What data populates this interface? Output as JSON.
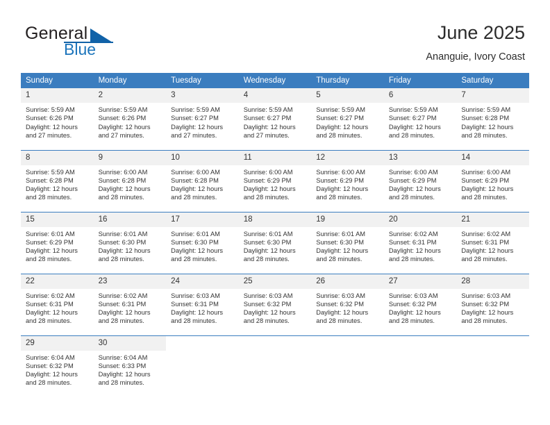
{
  "brand": {
    "name_top": "General",
    "name_bottom": "Blue",
    "accent_color": "#1162a8"
  },
  "header": {
    "title": "June 2025",
    "subtitle": "Ananguie, Ivory Coast",
    "header_bg": "#3b7dbf",
    "daynum_bg": "#f1f1f1"
  },
  "weekdays": [
    "Sunday",
    "Monday",
    "Tuesday",
    "Wednesday",
    "Thursday",
    "Friday",
    "Saturday"
  ],
  "labels": {
    "sunrise_prefix": "Sunrise:",
    "sunset_prefix": "Sunset:",
    "daylight_prefix": "Daylight:"
  },
  "weeks": [
    [
      {
        "day": "1",
        "sunrise": "Sunrise: 5:59 AM",
        "sunset": "Sunset: 6:26 PM",
        "daylight_1": "Daylight: 12 hours",
        "daylight_2": "and 27 minutes."
      },
      {
        "day": "2",
        "sunrise": "Sunrise: 5:59 AM",
        "sunset": "Sunset: 6:26 PM",
        "daylight_1": "Daylight: 12 hours",
        "daylight_2": "and 27 minutes."
      },
      {
        "day": "3",
        "sunrise": "Sunrise: 5:59 AM",
        "sunset": "Sunset: 6:27 PM",
        "daylight_1": "Daylight: 12 hours",
        "daylight_2": "and 27 minutes."
      },
      {
        "day": "4",
        "sunrise": "Sunrise: 5:59 AM",
        "sunset": "Sunset: 6:27 PM",
        "daylight_1": "Daylight: 12 hours",
        "daylight_2": "and 27 minutes."
      },
      {
        "day": "5",
        "sunrise": "Sunrise: 5:59 AM",
        "sunset": "Sunset: 6:27 PM",
        "daylight_1": "Daylight: 12 hours",
        "daylight_2": "and 28 minutes."
      },
      {
        "day": "6",
        "sunrise": "Sunrise: 5:59 AM",
        "sunset": "Sunset: 6:27 PM",
        "daylight_1": "Daylight: 12 hours",
        "daylight_2": "and 28 minutes."
      },
      {
        "day": "7",
        "sunrise": "Sunrise: 5:59 AM",
        "sunset": "Sunset: 6:28 PM",
        "daylight_1": "Daylight: 12 hours",
        "daylight_2": "and 28 minutes."
      }
    ],
    [
      {
        "day": "8",
        "sunrise": "Sunrise: 5:59 AM",
        "sunset": "Sunset: 6:28 PM",
        "daylight_1": "Daylight: 12 hours",
        "daylight_2": "and 28 minutes."
      },
      {
        "day": "9",
        "sunrise": "Sunrise: 6:00 AM",
        "sunset": "Sunset: 6:28 PM",
        "daylight_1": "Daylight: 12 hours",
        "daylight_2": "and 28 minutes."
      },
      {
        "day": "10",
        "sunrise": "Sunrise: 6:00 AM",
        "sunset": "Sunset: 6:28 PM",
        "daylight_1": "Daylight: 12 hours",
        "daylight_2": "and 28 minutes."
      },
      {
        "day": "11",
        "sunrise": "Sunrise: 6:00 AM",
        "sunset": "Sunset: 6:29 PM",
        "daylight_1": "Daylight: 12 hours",
        "daylight_2": "and 28 minutes."
      },
      {
        "day": "12",
        "sunrise": "Sunrise: 6:00 AM",
        "sunset": "Sunset: 6:29 PM",
        "daylight_1": "Daylight: 12 hours",
        "daylight_2": "and 28 minutes."
      },
      {
        "day": "13",
        "sunrise": "Sunrise: 6:00 AM",
        "sunset": "Sunset: 6:29 PM",
        "daylight_1": "Daylight: 12 hours",
        "daylight_2": "and 28 minutes."
      },
      {
        "day": "14",
        "sunrise": "Sunrise: 6:00 AM",
        "sunset": "Sunset: 6:29 PM",
        "daylight_1": "Daylight: 12 hours",
        "daylight_2": "and 28 minutes."
      }
    ],
    [
      {
        "day": "15",
        "sunrise": "Sunrise: 6:01 AM",
        "sunset": "Sunset: 6:29 PM",
        "daylight_1": "Daylight: 12 hours",
        "daylight_2": "and 28 minutes."
      },
      {
        "day": "16",
        "sunrise": "Sunrise: 6:01 AM",
        "sunset": "Sunset: 6:30 PM",
        "daylight_1": "Daylight: 12 hours",
        "daylight_2": "and 28 minutes."
      },
      {
        "day": "17",
        "sunrise": "Sunrise: 6:01 AM",
        "sunset": "Sunset: 6:30 PM",
        "daylight_1": "Daylight: 12 hours",
        "daylight_2": "and 28 minutes."
      },
      {
        "day": "18",
        "sunrise": "Sunrise: 6:01 AM",
        "sunset": "Sunset: 6:30 PM",
        "daylight_1": "Daylight: 12 hours",
        "daylight_2": "and 28 minutes."
      },
      {
        "day": "19",
        "sunrise": "Sunrise: 6:01 AM",
        "sunset": "Sunset: 6:30 PM",
        "daylight_1": "Daylight: 12 hours",
        "daylight_2": "and 28 minutes."
      },
      {
        "day": "20",
        "sunrise": "Sunrise: 6:02 AM",
        "sunset": "Sunset: 6:31 PM",
        "daylight_1": "Daylight: 12 hours",
        "daylight_2": "and 28 minutes."
      },
      {
        "day": "21",
        "sunrise": "Sunrise: 6:02 AM",
        "sunset": "Sunset: 6:31 PM",
        "daylight_1": "Daylight: 12 hours",
        "daylight_2": "and 28 minutes."
      }
    ],
    [
      {
        "day": "22",
        "sunrise": "Sunrise: 6:02 AM",
        "sunset": "Sunset: 6:31 PM",
        "daylight_1": "Daylight: 12 hours",
        "daylight_2": "and 28 minutes."
      },
      {
        "day": "23",
        "sunrise": "Sunrise: 6:02 AM",
        "sunset": "Sunset: 6:31 PM",
        "daylight_1": "Daylight: 12 hours",
        "daylight_2": "and 28 minutes."
      },
      {
        "day": "24",
        "sunrise": "Sunrise: 6:03 AM",
        "sunset": "Sunset: 6:31 PM",
        "daylight_1": "Daylight: 12 hours",
        "daylight_2": "and 28 minutes."
      },
      {
        "day": "25",
        "sunrise": "Sunrise: 6:03 AM",
        "sunset": "Sunset: 6:32 PM",
        "daylight_1": "Daylight: 12 hours",
        "daylight_2": "and 28 minutes."
      },
      {
        "day": "26",
        "sunrise": "Sunrise: 6:03 AM",
        "sunset": "Sunset: 6:32 PM",
        "daylight_1": "Daylight: 12 hours",
        "daylight_2": "and 28 minutes."
      },
      {
        "day": "27",
        "sunrise": "Sunrise: 6:03 AM",
        "sunset": "Sunset: 6:32 PM",
        "daylight_1": "Daylight: 12 hours",
        "daylight_2": "and 28 minutes."
      },
      {
        "day": "28",
        "sunrise": "Sunrise: 6:03 AM",
        "sunset": "Sunset: 6:32 PM",
        "daylight_1": "Daylight: 12 hours",
        "daylight_2": "and 28 minutes."
      }
    ],
    [
      {
        "day": "29",
        "sunrise": "Sunrise: 6:04 AM",
        "sunset": "Sunset: 6:32 PM",
        "daylight_1": "Daylight: 12 hours",
        "daylight_2": "and 28 minutes."
      },
      {
        "day": "30",
        "sunrise": "Sunrise: 6:04 AM",
        "sunset": "Sunset: 6:33 PM",
        "daylight_1": "Daylight: 12 hours",
        "daylight_2": "and 28 minutes."
      },
      {
        "day": "",
        "sunrise": "",
        "sunset": "",
        "daylight_1": "",
        "daylight_2": ""
      },
      {
        "day": "",
        "sunrise": "",
        "sunset": "",
        "daylight_1": "",
        "daylight_2": ""
      },
      {
        "day": "",
        "sunrise": "",
        "sunset": "",
        "daylight_1": "",
        "daylight_2": ""
      },
      {
        "day": "",
        "sunrise": "",
        "sunset": "",
        "daylight_1": "",
        "daylight_2": ""
      },
      {
        "day": "",
        "sunrise": "",
        "sunset": "",
        "daylight_1": "",
        "daylight_2": ""
      }
    ]
  ]
}
